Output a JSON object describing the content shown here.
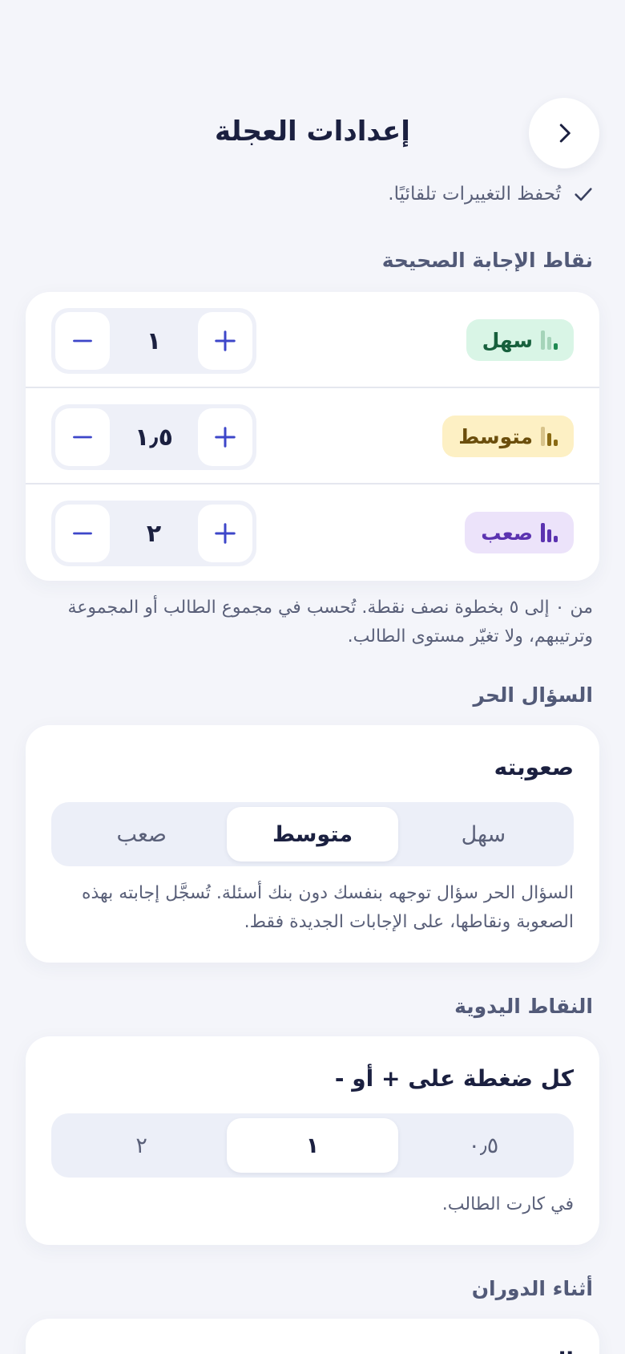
{
  "header": {
    "title": "إعدادات العجلة",
    "back_icon": "chevron-right-icon"
  },
  "autosave": {
    "text": "تُحفظ التغييرات تلقائيًا.",
    "icon": "check-icon"
  },
  "correct_points": {
    "section_title": "نقاط الإجابة الصحيحة",
    "rows": [
      {
        "label": "سهل",
        "value": "١",
        "level": 1,
        "color": "#1f8a52"
      },
      {
        "label": "متوسط",
        "value": "١٫٥",
        "level": 2,
        "color": "#8a6a14"
      },
      {
        "label": "صعب",
        "value": "٢",
        "level": 3,
        "color": "#5b33b0"
      }
    ],
    "helper": "من ٠ إلى ٥ بخطوة نصف نقطة. تُحسب في مجموع الطالب أو المجموعة وترتيبهم، ولا تغيّر مستوى الطالب."
  },
  "free_question": {
    "section_title": "السؤال الحر",
    "label": "صعوبته",
    "options": [
      "سهل",
      "متوسط",
      "صعب"
    ],
    "selected": "متوسط",
    "helper": "السؤال الحر سؤال توجهه بنفسك دون بنك أسئلة. تُسجَّل إجابته بهذه الصعوبة ونقاطها، على الإجابات الجديدة فقط."
  },
  "manual_points": {
    "section_title": "النقاط اليدوية",
    "label": "كل ضغطة على + أو -",
    "options": [
      "٠٫٥",
      "١",
      "٢"
    ],
    "selected": "١",
    "helper": "في كارت الطالب."
  },
  "during_spin": {
    "section_title": "أثناء الدوران",
    "peek_label": "الصوت"
  },
  "colors": {
    "accent": "#3d46c9",
    "background": "#f4f5fa"
  }
}
